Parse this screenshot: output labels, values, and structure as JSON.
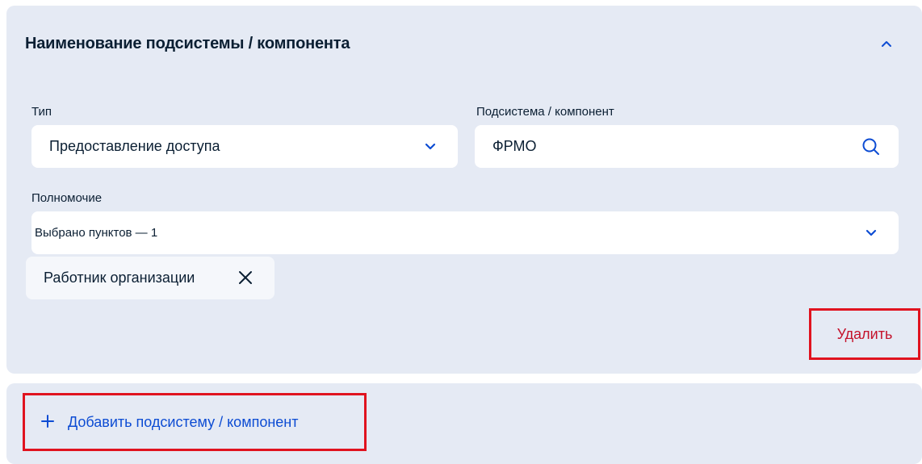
{
  "component_card": {
    "title": "Наименование подсистемы / компонента",
    "collapse_icon": "chevron-up-icon",
    "type_field": {
      "label": "Тип",
      "value": "Предоставление доступа",
      "icon": "chevron-down-icon"
    },
    "subsystem_field": {
      "label": "Подсистема / компонент",
      "value": "ФРМО",
      "icon": "search-icon"
    },
    "authority_field": {
      "label": "Полномочие",
      "value": "Выбрано пунктов — 1",
      "icon": "chevron-down-icon"
    },
    "selected_chips": [
      {
        "label": "Работник организации",
        "icon": "close-icon"
      }
    ],
    "delete_label": "Удалить"
  },
  "add_section": {
    "icon": "plus-icon",
    "label": "Добавить подсистему / компонент"
  },
  "colors": {
    "card_bg": "#e5eaf4",
    "field_bg": "#ffffff",
    "accent_blue": "#0d4cd3",
    "delete_red": "#c4122b",
    "highlight_red": "#e0131f"
  }
}
